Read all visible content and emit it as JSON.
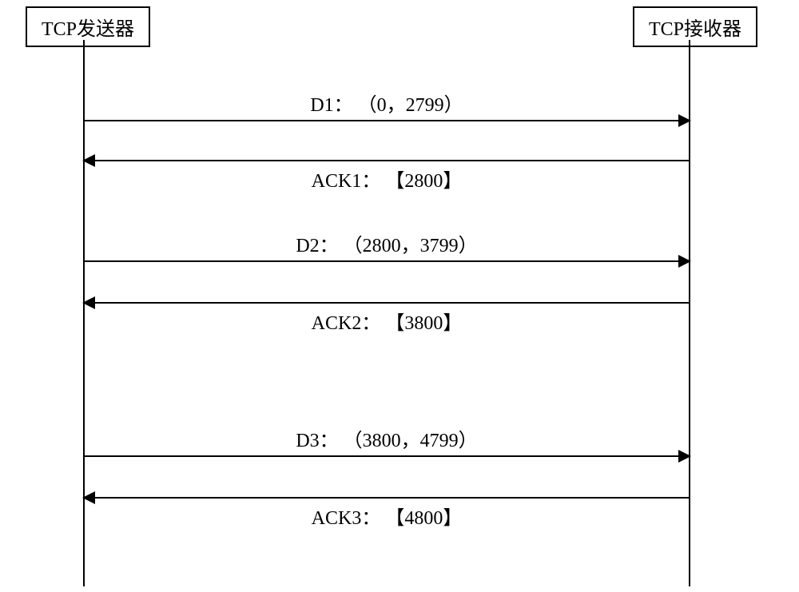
{
  "participants": {
    "sender": "TCP发送器",
    "receiver": "TCP接收器"
  },
  "messages": {
    "d1": "D1： （0，2799）",
    "ack1": "ACK1： 【2800】",
    "d2": "D2： （2800，3799）",
    "ack2": "ACK2： 【3800】",
    "d3": "D3： （3800，4799）",
    "ack3": "ACK3： 【4800】"
  },
  "chart_data": {
    "type": "sequence-diagram",
    "participants": [
      "TCP发送器",
      "TCP接收器"
    ],
    "exchanges": [
      {
        "name": "D1",
        "from": "TCP发送器",
        "to": "TCP接收器",
        "seq_range": [
          0,
          2799
        ]
      },
      {
        "name": "ACK1",
        "from": "TCP接收器",
        "to": "TCP发送器",
        "ack": 2800
      },
      {
        "name": "D2",
        "from": "TCP发送器",
        "to": "TCP接收器",
        "seq_range": [
          2800,
          3799
        ]
      },
      {
        "name": "ACK2",
        "from": "TCP接收器",
        "to": "TCP发送器",
        "ack": 3800
      },
      {
        "name": "D3",
        "from": "TCP发送器",
        "to": "TCP接收器",
        "seq_range": [
          3800,
          4799
        ]
      },
      {
        "name": "ACK3",
        "from": "TCP接收器",
        "to": "TCP发送器",
        "ack": 4800
      }
    ]
  }
}
